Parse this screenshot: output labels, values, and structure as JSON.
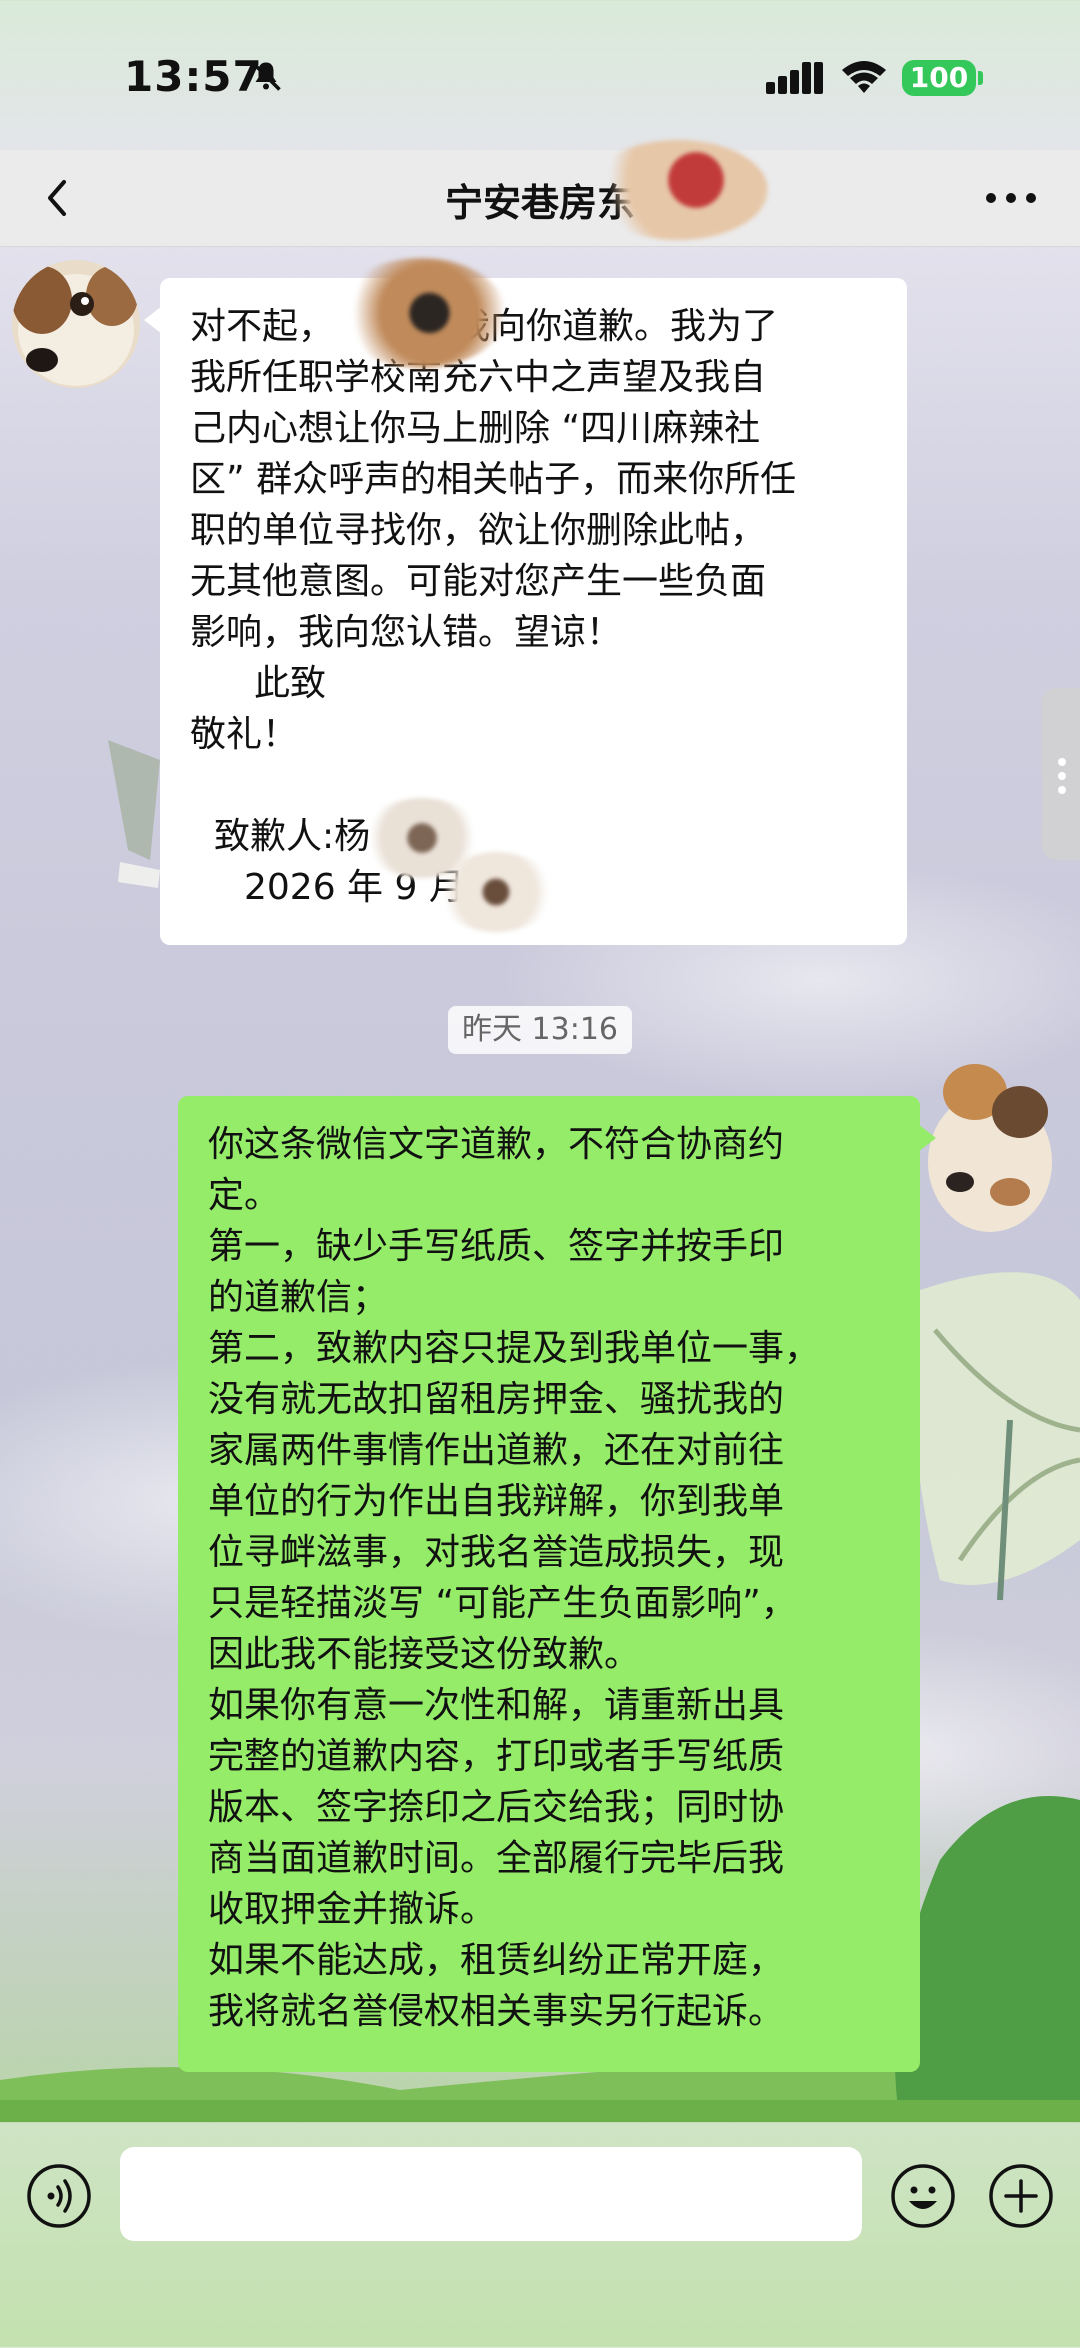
{
  "status_bar": {
    "time": "13:57",
    "battery": "100",
    "icons": [
      "bell-slash-icon",
      "signal-icon",
      "wifi-icon",
      "battery-icon"
    ]
  },
  "nav": {
    "title": "宁安巷房东",
    "back_icon": "chevron-left-icon",
    "more_icon": "ellipsis-icon"
  },
  "messages": [
    {
      "direction": "incoming",
      "lines": [
        "对不起，",
        "我向你道歉。我为了",
        "我所任职学校南充六中之声望及我自",
        "己内心想让你马上删除 “四川麻辣社",
        "区” 群众呼声的相关帖子，而来你所任",
        "职的单位寻找你，欲让你删除此帖，",
        "无其他意图。可能对您产生一些负面",
        "影响，我向您认错。望谅！",
        "此致",
        "敬礼！",
        "",
        "致歉人:杨",
        "2026 年 9 月"
      ]
    },
    {
      "direction": "outgoing",
      "lines": [
        "你这条微信文字道歉，不符合协商约",
        "定。",
        "第一，缺少手写纸质、签字并按手印",
        "的道歉信；",
        "第二，致歉内容只提及到我单位一事，",
        "没有就无故扣留租房押金、骚扰我的",
        "家属两件事情作出道歉，还在对前往",
        "单位的行为作出自我辩解，你到我单",
        "位寻衅滋事，对我名誉造成损失，现",
        "只是轻描淡写 “可能产生负面影响”，",
        "因此我不能接受这份致歉。",
        "如果你有意一次性和解，请重新出具",
        "完整的道歉内容，打印或者手写纸质",
        "版本、签字捺印之后交给我；同时协",
        "商当面道歉时间。全部履行完毕后我",
        "收取押金并撤诉。",
        "如果不能达成，租赁纠纷正常开庭，",
        "我将就名誉侵权相关事实另行起诉。"
      ]
    }
  ],
  "timestamp": "昨天 13:16",
  "input_bar": {
    "placeholder": "",
    "icons": [
      "voice-icon",
      "emoji-icon",
      "plus-icon"
    ]
  },
  "colors": {
    "outgoing_bubble": "#95ec69",
    "incoming_bubble": "#ffffff",
    "battery": "#34c759"
  }
}
